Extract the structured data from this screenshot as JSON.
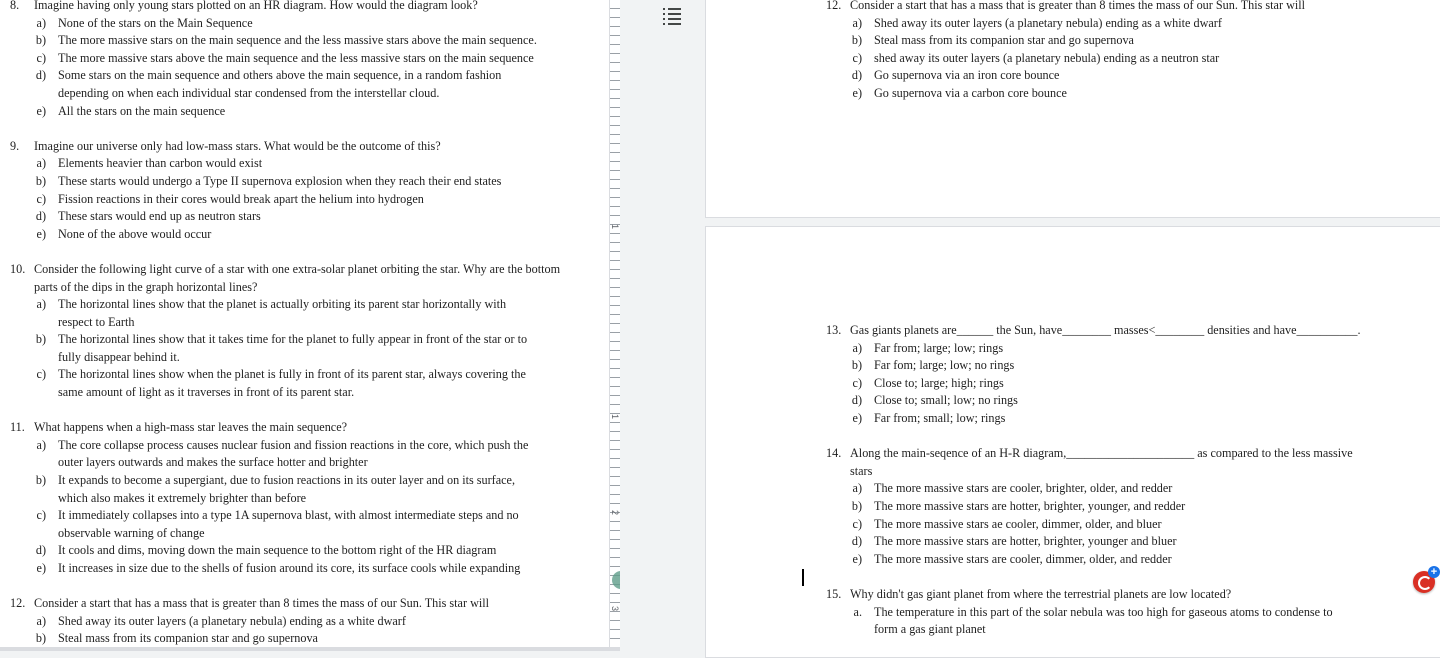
{
  "left": {
    "q8": {
      "num": "8.",
      "text": "Imagine having only young stars plotted on an HR diagram. How would the diagram look?",
      "options": [
        {
          "label": "a)",
          "lines": [
            "None of the stars on the Main Sequence"
          ]
        },
        {
          "label": "b)",
          "lines": [
            "The more massive stars on the main sequence and the less massive stars above the main sequence."
          ]
        },
        {
          "label": "c)",
          "lines": [
            "The more massive stars above the main sequence and the less massive stars on the main sequence"
          ]
        },
        {
          "label": "d)",
          "lines": [
            "Some stars on the main sequence and others above the main sequence, in a random fashion",
            "depending on when each individual star condensed from the interstellar cloud."
          ]
        },
        {
          "label": "e)",
          "lines": [
            "All the stars on the main sequence"
          ]
        }
      ]
    },
    "q9": {
      "num": "9.",
      "text": "Imagine our universe only had low-mass stars. What would be the outcome of this?",
      "options": [
        {
          "label": "a)",
          "lines": [
            "Elements heavier than carbon would exist"
          ]
        },
        {
          "label": "b)",
          "lines": [
            "These starts would undergo a Type II supernova explosion when they reach their end states"
          ]
        },
        {
          "label": "c)",
          "lines": [
            "Fission reactions in their cores would break apart the helium into hydrogen"
          ]
        },
        {
          "label": "d)",
          "lines": [
            "These stars would end up as neutron stars"
          ]
        },
        {
          "label": "e)",
          "lines": [
            "None of the above would occur"
          ]
        }
      ]
    },
    "q10": {
      "num": "10.",
      "lines": [
        "Consider the following light curve of a star with one extra-solar planet orbiting the star. Why are the bottom",
        "parts of the dips in the graph horizontal lines?"
      ],
      "options": [
        {
          "label": "a)",
          "lines": [
            "The horizontal lines show that the planet is actually orbiting its parent star horizontally with",
            "respect to Earth"
          ]
        },
        {
          "label": "b)",
          "lines": [
            "The horizontal lines show that it takes time for the planet to fully appear in front of the star or to",
            "fully disappear behind it."
          ]
        },
        {
          "label": "c)",
          "lines": [
            "The horizontal lines show when the planet is fully in front of its parent star, always covering the",
            "same amount of light as it traverses in front of its parent star."
          ]
        }
      ]
    },
    "q11": {
      "num": "11.",
      "text": "What happens when a high-mass star leaves the main sequence?",
      "options": [
        {
          "label": "a)",
          "lines": [
            "The core collapse process causes nuclear fusion and fission reactions in the core, which push the",
            "outer layers outwards and makes the surface hotter and brighter"
          ]
        },
        {
          "label": "b)",
          "lines": [
            "It expands to become a supergiant, due to fusion reactions in its outer layer and on its surface,",
            "which also makes it extremely brighter than before"
          ]
        },
        {
          "label": "c)",
          "lines": [
            "It immediately collapses into a type 1A supernova blast, with almost intermediate steps and no",
            "observable warning of change"
          ]
        },
        {
          "label": "d)",
          "lines": [
            "It cools and dims, moving down the main sequence to the bottom right of the HR diagram"
          ]
        },
        {
          "label": "e)",
          "lines": [
            "It increases in size due to the shells of fusion around its core, its surface cools while expanding"
          ]
        }
      ]
    },
    "q12": {
      "num": "12.",
      "text": "Consider a start that has a mass that is greater than 8 times the mass of our Sun. This star will",
      "options": [
        {
          "label": "a)",
          "lines": [
            "Shed away its outer layers (a planetary nebula) ending as a white dwarf"
          ]
        },
        {
          "label": "b)",
          "lines": [
            "Steal mass from its companion star and go supernova"
          ]
        }
      ]
    },
    "ruler_marks": [
      "1",
      "1",
      "2",
      "3"
    ]
  },
  "right": {
    "q12": {
      "num": "12.",
      "text": "Consider a start that has a mass that is greater than 8 times the mass of our Sun. This star will",
      "options": [
        {
          "label": "a)",
          "lines": [
            "Shed away its outer layers (a planetary nebula) ending as a white dwarf"
          ]
        },
        {
          "label": "b)",
          "lines": [
            "Steal mass from its companion star and go supernova"
          ]
        },
        {
          "label": "c)",
          "lines": [
            "shed away its outer layers (a planetary nebula) ending as a neutron star"
          ]
        },
        {
          "label": "d)",
          "lines": [
            "Go supernova via an iron core bounce"
          ]
        },
        {
          "label": "e)",
          "lines": [
            "Go supernova via a carbon core bounce"
          ]
        }
      ]
    },
    "q13": {
      "num": "13.",
      "text": "Gas giants planets are______ the Sun, have________ masses<________ densities and have__________.",
      "options": [
        {
          "label": "a)",
          "lines": [
            "Far from;  large; low; rings"
          ]
        },
        {
          "label": "b)",
          "lines": [
            "Far fom; large; low; no rings"
          ]
        },
        {
          "label": "c)",
          "lines": [
            "Close to; large; high; rings"
          ]
        },
        {
          "label": "d)",
          "lines": [
            "Close to; small; low; no rings"
          ]
        },
        {
          "label": "e)",
          "lines": [
            "Far from; small; low; rings"
          ]
        }
      ]
    },
    "q14": {
      "num": "14.",
      "lines": [
        "Along the main-seqence of an H-R diagram,_____________________ as compared to the less massive",
        "stars"
      ],
      "options": [
        {
          "label": "a)",
          "lines": [
            "The more massive stars are cooler, brighter, older, and redder"
          ]
        },
        {
          "label": "b)",
          "lines": [
            "The more massive stars are hotter, brighter, younger, and redder"
          ]
        },
        {
          "label": "c)",
          "lines": [
            "The more massive stars ae cooler, dimmer, older, and bluer"
          ]
        },
        {
          "label": "d)",
          "lines": [
            "The more massive stars are hotter, brighter, younger and bluer"
          ]
        },
        {
          "label": "e)",
          "lines": [
            "The more massive stars are cooler, dimmer, older, and redder"
          ]
        }
      ]
    },
    "q15": {
      "num": "15.",
      "text": "Why didn't gas giant planet from where the terrestrial planets are low located?",
      "options": [
        {
          "label": "a.",
          "lines": [
            "The temperature in this part of the solar nebula was too high for gaseous atoms to condense to",
            "form a gas giant planet"
          ]
        }
      ]
    }
  },
  "icons": {
    "outline": "document-outline-icon",
    "assistant": "grammarly-assistant-icon"
  },
  "colors": {
    "spell_error": "#d93025",
    "grammar_hint": "#f1b300",
    "assistant_accent": "#1a73e8"
  }
}
